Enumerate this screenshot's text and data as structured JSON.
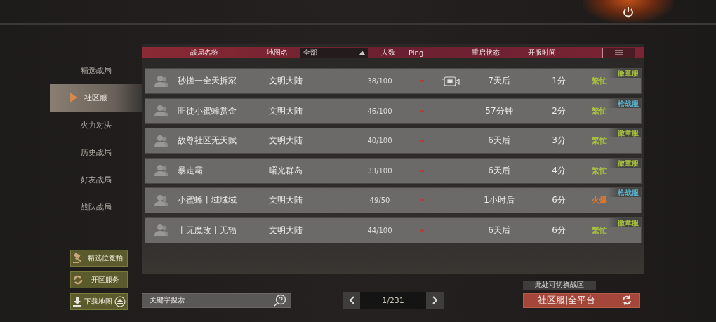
{
  "sidebar": {
    "items": [
      {
        "label": "精选战局",
        "selected": false
      },
      {
        "label": "社区服",
        "selected": true
      },
      {
        "label": "火力对决",
        "selected": false
      },
      {
        "label": "历史战局",
        "selected": false
      },
      {
        "label": "好友战局",
        "selected": false
      },
      {
        "label": "战队战局",
        "selected": false
      }
    ],
    "actions": [
      {
        "label": "精选位竞拍",
        "kind": "auction"
      },
      {
        "label": "开区服务",
        "kind": "service"
      },
      {
        "label": "下载地图",
        "kind": "download"
      }
    ]
  },
  "table": {
    "columns": {
      "name": "战局名称",
      "map": "地图名",
      "filter": "全部",
      "players": "人数",
      "ping": "Ping",
      "restart": "重启状态",
      "open_time": "开服时间"
    },
    "rows": [
      {
        "name": "秒搓一全天拆家",
        "map": "文明大陆",
        "players": "38/100",
        "live": true,
        "restart": "7天后",
        "open_time": "1分",
        "status": {
          "label": "繁忙",
          "color": "#a8c040"
        },
        "badge": {
          "label": "徽章服",
          "color": "#a8c040"
        }
      },
      {
        "name": "匪徒小蜜蜂赏金",
        "map": "文明大陆",
        "players": "46/100",
        "live": false,
        "restart": "57分钟",
        "open_time": "2分",
        "status": {
          "label": "繁忙",
          "color": "#a8c040"
        },
        "badge": {
          "label": "枪战服",
          "color": "#5ab0c8"
        }
      },
      {
        "name": "故尊社区无天赋",
        "map": "文明大陆",
        "players": "40/100",
        "live": false,
        "restart": "6天后",
        "open_time": "3分",
        "status": {
          "label": "繁忙",
          "color": "#a8c040"
        },
        "badge": {
          "label": "徽章服",
          "color": "#a8c040"
        }
      },
      {
        "name": "暴走霸",
        "map": "曙光群岛",
        "players": "33/100",
        "live": false,
        "restart": "6天后",
        "open_time": "4分",
        "status": {
          "label": "繁忙",
          "color": "#a8c040"
        },
        "badge": {
          "label": "徽章服",
          "color": "#a8c040"
        }
      },
      {
        "name": "小蜜蜂丨域域域",
        "map": "文明大陆",
        "players": "49/50",
        "live": false,
        "restart": "1小时后",
        "open_time": "6分",
        "status": {
          "label": "火爆",
          "color": "#e07a30"
        },
        "badge": {
          "label": "枪战服",
          "color": "#5ab0c8"
        }
      },
      {
        "name": "丨无魔改丨无辐",
        "map": "文明大陆",
        "players": "44/100",
        "live": false,
        "restart": "6天后",
        "open_time": "6分",
        "status": {
          "label": "繁忙",
          "color": "#a8c040"
        },
        "badge": {
          "label": "徽章服",
          "color": "#a8c040"
        }
      }
    ]
  },
  "search": {
    "placeholder": "关键字搜索"
  },
  "pagination": {
    "page": "1/231"
  },
  "region": {
    "tooltip": "此处可切换战区",
    "label": "社区服|全平台"
  }
}
